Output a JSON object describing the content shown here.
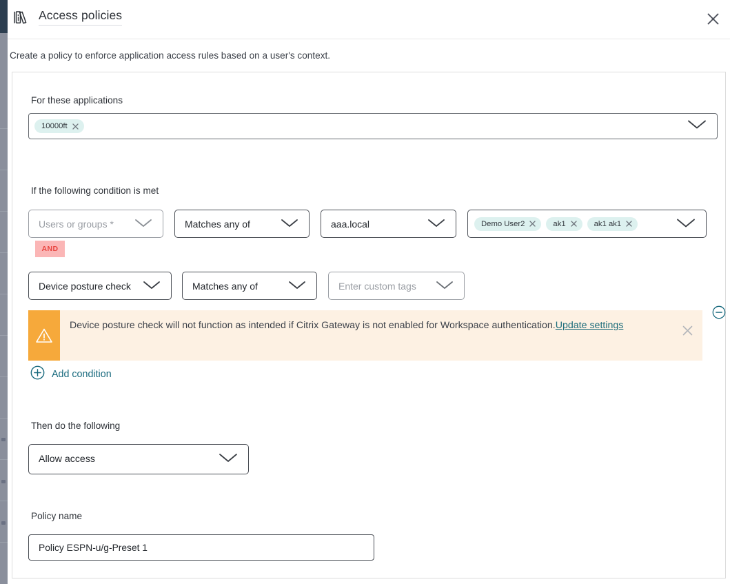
{
  "header": {
    "title": "Access policies",
    "icon": "books-icon",
    "close_icon": "close-icon"
  },
  "subtitle": "Create a policy to enforce application access rules based on a user's context.",
  "sections": {
    "applications": {
      "label": "For these applications",
      "chips": [
        {
          "label": "10000ft",
          "remove_icon": "close-icon"
        }
      ],
      "caret_icon": "chevron-down-icon"
    },
    "condition": {
      "label": "If the following condition is met",
      "row1": {
        "criteria": {
          "value": "Users or groups *",
          "is_placeholder": true,
          "caret_icon": "chevron-down-icon"
        },
        "operator": {
          "value": "Matches any of",
          "caret_icon": "chevron-down-icon"
        },
        "domain": {
          "value": "aaa.local",
          "caret_icon": "chevron-down-icon"
        },
        "values": {
          "chips": [
            {
              "label": "Demo User2",
              "remove_icon": "close-icon"
            },
            {
              "label": "ak1",
              "remove_icon": "close-icon"
            },
            {
              "label": "ak1 ak1",
              "remove_icon": "close-icon"
            }
          ],
          "caret_icon": "chevron-down-icon"
        }
      },
      "joiner": "AND",
      "row2": {
        "criteria": {
          "value": "Device posture check",
          "caret_icon": "chevron-down-icon"
        },
        "operator": {
          "value": "Matches any of",
          "caret_icon": "chevron-down-icon"
        },
        "values": {
          "value": "Enter custom tags",
          "is_placeholder": true,
          "caret_icon": "chevron-down-icon"
        }
      },
      "warning": {
        "icon": "warning-triangle-icon",
        "text": "Device posture check will not function as intended if Citrix Gateway is not enabled for Workspace authentication.",
        "link": "Update settings",
        "close_icon": "close-icon"
      },
      "remove_condition_icon": "circle-minus-icon",
      "add_condition": {
        "icon": "circle-plus-icon",
        "label": "Add condition"
      }
    },
    "action": {
      "label": "Then do the following",
      "value": "Allow access",
      "caret_icon": "chevron-down-icon"
    },
    "policy_name": {
      "label": "Policy name",
      "value": "Policy ESPN-u/g-Preset 1",
      "placeholder": "Policy name"
    }
  },
  "colors": {
    "chip_bg": "#ddf1ef",
    "and_badge_bg": "#fbb6b6",
    "and_badge_text": "#e8443f",
    "warning_bg": "#fdf1e3",
    "warning_icon_bg": "#f6a93b",
    "link": "#17697d",
    "text": "#2e3238"
  }
}
